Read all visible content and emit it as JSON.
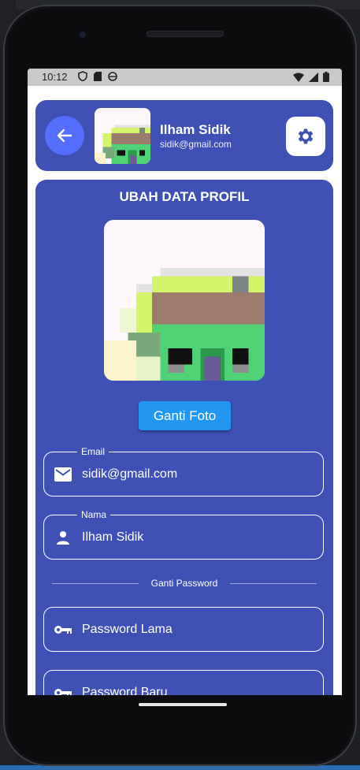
{
  "status_bar": {
    "time": "10:12"
  },
  "header": {
    "name": "Ilham Sidik",
    "email": "sidik@gmail.com"
  },
  "form": {
    "title": "UBAH DATA PROFIL",
    "change_photo_label": "Ganti Foto",
    "fields": [
      {
        "label": "Email",
        "value": "sidik@gmail.com",
        "icon": "mail-icon"
      },
      {
        "label": "Nama",
        "value": "Ilham Sidik",
        "icon": "person-icon"
      },
      {
        "label": "",
        "value": "Password Lama",
        "icon": "key-icon"
      },
      {
        "label": "",
        "value": "Password Baru",
        "icon": "key-icon"
      }
    ],
    "divider_label": "Ganti Password"
  },
  "colors": {
    "primary": "#3f51b5",
    "accent_back": "#536dfe",
    "button": "#2196f3",
    "screen_bg": "#ffffff"
  }
}
